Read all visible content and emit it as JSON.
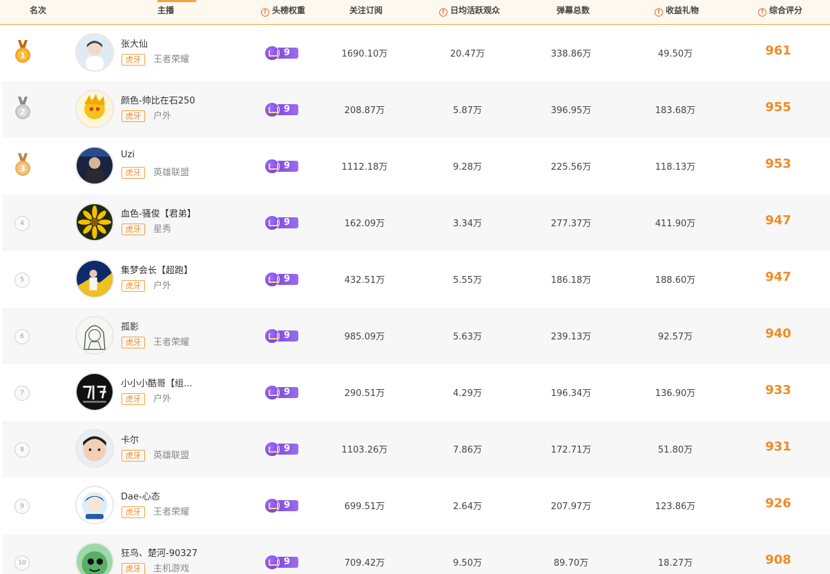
{
  "header": {
    "rank": "名次",
    "streamer": "主播",
    "weight": "头榜权重",
    "followers": "关注订阅",
    "daily_active": "日均活跃观众",
    "danmaku": "弹幕总数",
    "gifts": "收益礼物",
    "score": "综合评分",
    "info_glyph": "!"
  },
  "colors": {
    "accent": "#f5a040",
    "score": "#f08a24",
    "badge": "#7c4bdc",
    "gold": "#f5a623",
    "silver": "#b9b9b9",
    "bronze": "#f0b060"
  },
  "rows": [
    {
      "rank": "1",
      "medal": "gold",
      "name": "张大仙",
      "platform": "虎牙",
      "category": "王者荣耀",
      "weight": "9",
      "followers": "1690.10万",
      "daily_active": "20.47万",
      "danmaku": "338.86万",
      "gifts": "49.50万",
      "score": "961"
    },
    {
      "rank": "2",
      "medal": "silver",
      "name": "颜色-帅比在石250",
      "platform": "虎牙",
      "category": "户外",
      "weight": "9",
      "followers": "208.87万",
      "daily_active": "5.87万",
      "danmaku": "396.95万",
      "gifts": "183.68万",
      "score": "955"
    },
    {
      "rank": "3",
      "medal": "bronze",
      "name": "Uzi",
      "platform": "虎牙",
      "category": "英雄联盟",
      "weight": "9",
      "followers": "1112.18万",
      "daily_active": "9.28万",
      "danmaku": "225.56万",
      "gifts": "118.13万",
      "score": "953"
    },
    {
      "rank": "4",
      "medal": "",
      "name": "血色-骚俊【君弟】",
      "platform": "虎牙",
      "category": "星秀",
      "weight": "9",
      "followers": "162.09万",
      "daily_active": "3.34万",
      "danmaku": "277.37万",
      "gifts": "411.90万",
      "score": "947"
    },
    {
      "rank": "5",
      "medal": "",
      "name": "集梦会长【超跑】",
      "platform": "虎牙",
      "category": "户外",
      "weight": "9",
      "followers": "432.51万",
      "daily_active": "5.55万",
      "danmaku": "186.18万",
      "gifts": "188.60万",
      "score": "947"
    },
    {
      "rank": "6",
      "medal": "",
      "name": "孤影",
      "platform": "虎牙",
      "category": "王者荣耀",
      "weight": "9",
      "followers": "985.09万",
      "daily_active": "5.63万",
      "danmaku": "239.13万",
      "gifts": "92.57万",
      "score": "940"
    },
    {
      "rank": "7",
      "medal": "",
      "name": "小小小酷哥【组...",
      "platform": "虎牙",
      "category": "户外",
      "weight": "9",
      "followers": "290.51万",
      "daily_active": "4.29万",
      "danmaku": "196.34万",
      "gifts": "136.90万",
      "score": "933"
    },
    {
      "rank": "8",
      "medal": "",
      "name": "卡尔",
      "platform": "虎牙",
      "category": "英雄联盟",
      "weight": "9",
      "followers": "1103.26万",
      "daily_active": "7.86万",
      "danmaku": "172.71万",
      "gifts": "51.80万",
      "score": "931"
    },
    {
      "rank": "9",
      "medal": "",
      "name": "Dae-心态",
      "platform": "虎牙",
      "category": "王者荣耀",
      "weight": "9",
      "followers": "699.51万",
      "daily_active": "2.64万",
      "danmaku": "207.97万",
      "gifts": "123.86万",
      "score": "926"
    },
    {
      "rank": "10",
      "medal": "",
      "name": "狂鸟、楚河-90327",
      "platform": "虎牙",
      "category": "主机游戏",
      "weight": "9",
      "followers": "709.42万",
      "daily_active": "9.50万",
      "danmaku": "89.70万",
      "gifts": "18.27万",
      "score": "908"
    }
  ]
}
